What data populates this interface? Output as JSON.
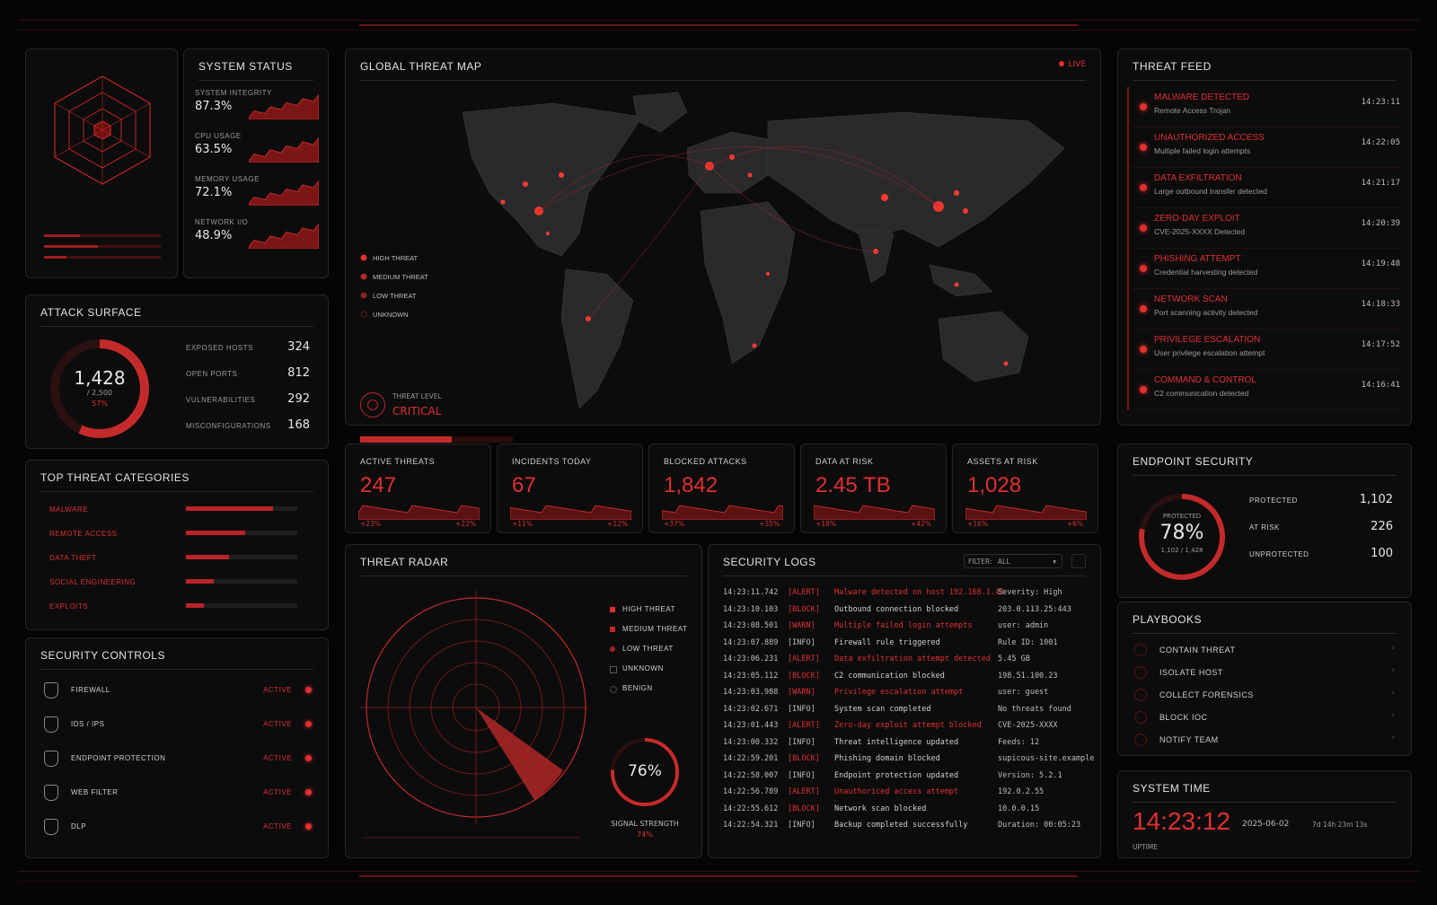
{
  "system_status": {
    "title": "SYSTEM STATUS",
    "metrics": [
      {
        "label": "SYSTEM INTEGRITY",
        "value": "87.3%"
      },
      {
        "label": "CPU USAGE",
        "value": "63.5%"
      },
      {
        "label": "MEMORY USAGE",
        "value": "72.1%"
      },
      {
        "label": "NETWORK I/O",
        "value": "48.9%"
      }
    ]
  },
  "threat_map": {
    "title": "GLOBAL THREAT MAP",
    "live": "LIVE",
    "legend": [
      "HIGH THREAT",
      "MEDIUM THREAT",
      "LOW THREAT",
      "UNKNOWN"
    ],
    "threat_level_label": "THREAT LEVEL",
    "threat_level_value": "CRITICAL",
    "threat_level_fill": 0.6
  },
  "threat_feed": {
    "title": "THREAT FEED",
    "items": [
      {
        "title": "MALWARE DETECTED",
        "sub": "Remote Access Trojan",
        "time": "14:23:11"
      },
      {
        "title": "UNAUTHORIZED ACCESS",
        "sub": "Multiple failed login attempts",
        "time": "14:22:05"
      },
      {
        "title": "DATA EXFILTRATION",
        "sub": "Large outbound transfer detected",
        "time": "14:21:17"
      },
      {
        "title": "ZERO-DAY EXPLOIT",
        "sub": "CVE-2025-XXXX Detected",
        "time": "14:20:39"
      },
      {
        "title": "PHISHING ATTEMPT",
        "sub": "Credential harvesting detected",
        "time": "14:19:48"
      },
      {
        "title": "NETWORK SCAN",
        "sub": "Port scanning activity detected",
        "time": "14:18:33"
      },
      {
        "title": "PRIVILEGE ESCALATION",
        "sub": "User privilege escalation attempt",
        "time": "14:17:52"
      },
      {
        "title": "COMMAND & CONTROL",
        "sub": "C2 communication detected",
        "time": "14:16:41"
      }
    ]
  },
  "attack_surface": {
    "title": "ATTACK SURFACE",
    "total": "1,428",
    "of": "/ 2,500",
    "pct": "57%",
    "fill": 0.57,
    "rows": [
      {
        "label": "EXPOSED HOSTS",
        "value": "324"
      },
      {
        "label": "OPEN PORTS",
        "value": "812"
      },
      {
        "label": "VULNERABILITIES",
        "value": "292"
      },
      {
        "label": "MISCONFIGURATIONS",
        "value": "168"
      }
    ]
  },
  "top_threats": {
    "title": "TOP THREAT CATEGORIES",
    "rows": [
      {
        "label": "MALWARE",
        "fill": 0.78
      },
      {
        "label": "REMOTE ACCESS",
        "fill": 0.53
      },
      {
        "label": "DATA THEFT",
        "fill": 0.39
      },
      {
        "label": "SOCIAL ENGINEERING",
        "fill": 0.25
      },
      {
        "label": "EXPLOITS",
        "fill": 0.16
      }
    ]
  },
  "security_controls": {
    "title": "SECURITY CONTROLS",
    "items": [
      {
        "label": "FIREWALL",
        "status": "ACTIVE"
      },
      {
        "label": "IDS / IPS",
        "status": "ACTIVE"
      },
      {
        "label": "ENDPOINT PROTECTION",
        "status": "ACTIVE"
      },
      {
        "label": "WEB FILTER",
        "status": "ACTIVE"
      },
      {
        "label": "DLP",
        "status": "ACTIVE"
      }
    ]
  },
  "stats": [
    {
      "label": "ACTIVE THREATS",
      "value": "247",
      "left": "+23%",
      "right": "+22%"
    },
    {
      "label": "INCIDENTS TODAY",
      "value": "67",
      "left": "+11%",
      "right": "+12%"
    },
    {
      "label": "BLOCKED ATTACKS",
      "value": "1,842",
      "left": "+37%",
      "right": "+35%"
    },
    {
      "label": "DATA AT RISK",
      "value": "2.45 TB",
      "left": "+18%",
      "right": "+42%"
    },
    {
      "label": "ASSETS AT RISK",
      "value": "1,028",
      "left": "+16%",
      "right": "+6%"
    }
  ],
  "radar": {
    "title": "THREAT RADAR",
    "legend": [
      "HIGH THREAT",
      "MEDIUM THREAT",
      "LOW THREAT",
      "UNKNOWN",
      "BENIGN"
    ],
    "signal_value": "76%",
    "signal_label": "SIGNAL STRENGTH",
    "signal_sub": "74%",
    "signal_fill": 0.76
  },
  "logs": {
    "title": "SECURITY LOGS",
    "filter_label": "FILTER:",
    "filter_value": "ALL",
    "rows": [
      {
        "time": "14:23:11.742",
        "level": "ALERT",
        "msg": "Malware detected on host 192.168.1.45",
        "detail": "Severity: High"
      },
      {
        "time": "14:23:10.103",
        "level": "BLOCK",
        "msg": "Outbound connection blocked",
        "detail": "203.0.113.25:443"
      },
      {
        "time": "14:23:08.501",
        "level": "WARN",
        "msg": "Multiple failed login attempts",
        "detail": "user: admin"
      },
      {
        "time": "14:23:07.889",
        "level": "INFO",
        "msg": "Firewall rule triggered",
        "detail": "Rule ID: 1001"
      },
      {
        "time": "14:23:06.231",
        "level": "ALERT",
        "msg": "Data exfiltration attempt detected",
        "detail": "5.45 GB"
      },
      {
        "time": "14:23:05.112",
        "level": "BLOCK",
        "msg": "C2 communication blocked",
        "detail": "198.51.100.23"
      },
      {
        "time": "14:23:03.988",
        "level": "WARN",
        "msg": "Privilege escalation attempt",
        "detail": "user: guest"
      },
      {
        "time": "14:23:02.671",
        "level": "INFO",
        "msg": "System scan completed",
        "detail": "No threats found"
      },
      {
        "time": "14:23:01.443",
        "level": "ALERT",
        "msg": "Zero-day exploit attempt blocked",
        "detail": "CVE-2025-XXXX"
      },
      {
        "time": "14:23:00.332",
        "level": "INFO",
        "msg": "Threat intelligence updated",
        "detail": "Feeds: 12"
      },
      {
        "time": "14:22:59.201",
        "level": "BLOCK",
        "msg": "Phishing domain blocked",
        "detail": "supicous-site.example"
      },
      {
        "time": "14:22:58.007",
        "level": "INFO",
        "msg": "Endpoint protection updated",
        "detail": "Version: 5.2.1"
      },
      {
        "time": "14:22:56.789",
        "level": "ALERT",
        "msg": "Unauthoriced access attempt",
        "detail": "192.0.2.55"
      },
      {
        "time": "14:22:55.612",
        "level": "BLOCK",
        "msg": "Network scan blocked",
        "detail": "10.0.0.15"
      },
      {
        "time": "14:22:54.321",
        "level": "INFO",
        "msg": "Backup completed successfully",
        "detail": "Duration: 00:05:23"
      }
    ]
  },
  "endpoint": {
    "title": "ENDPOINT SECURITY",
    "ring_label": "PROTECTED",
    "pct": "78%",
    "sub": "1,102 / 1,428",
    "fill": 0.78,
    "rows": [
      {
        "label": "PROTECTED",
        "value": "1,102"
      },
      {
        "label": "AT RISK",
        "value": "226"
      },
      {
        "label": "UNPROTECTED",
        "value": "100"
      }
    ]
  },
  "playbooks": {
    "title": "PLAYBOOKS",
    "items": [
      "CONTAIN THREAT",
      "ISOLATE HOST",
      "COLLECT FORENSICS",
      "BLOCK IOC",
      "NOTIFY TEAM"
    ]
  },
  "system_time": {
    "title": "SYSTEM TIME",
    "time": "14:23:12",
    "date": "2025-06-02",
    "uptime_label": "UPTIME",
    "uptime_value": "7d 14h 23m 13s"
  },
  "colors": {
    "accent": "#e0302f",
    "panel": "#0c0c0d",
    "border": "#262626"
  }
}
